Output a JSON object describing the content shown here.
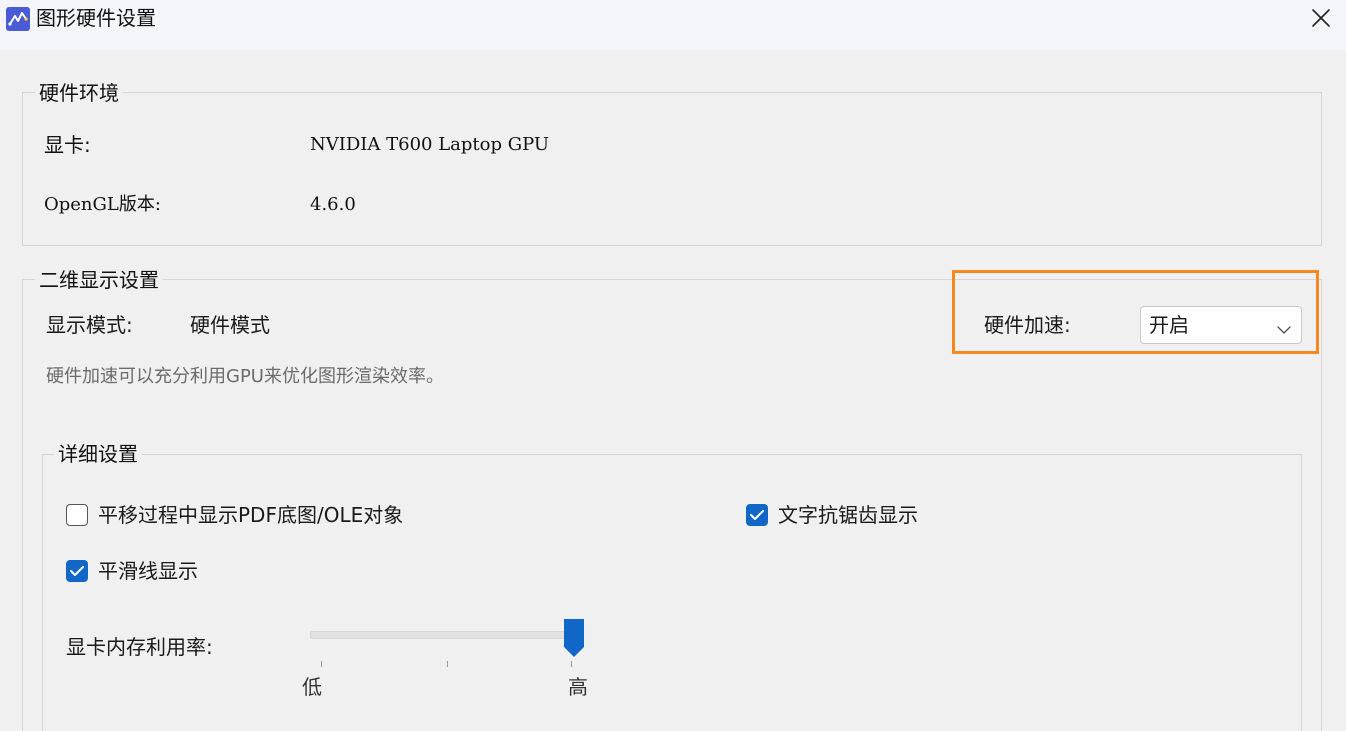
{
  "window": {
    "title": "图形硬件设置"
  },
  "hardware": {
    "legend": "硬件环境",
    "gpu_label": "显卡:",
    "gpu_value": "NVIDIA T600 Laptop GPU",
    "opengl_label": "OpenGL版本:",
    "opengl_value": "4.6.0"
  },
  "display2d": {
    "legend": "二维显示设置",
    "mode_label": "显示模式:",
    "mode_value": "硬件模式",
    "hint": "硬件加速可以充分利用GPU来优化图形渲染效率。",
    "accel_label": "硬件加速:",
    "accel_selected": "开启"
  },
  "details": {
    "legend": "详细设置",
    "options": [
      {
        "label": "平移过程中显示PDF底图/OLE对象",
        "checked": false
      },
      {
        "label": "文字抗锯齿显示",
        "checked": true
      },
      {
        "label": "平滑线显示",
        "checked": true
      }
    ],
    "memory_label": "显卡内存利用率:",
    "slider_min_label": "低",
    "slider_max_label": "高",
    "memory_level": 1.0
  },
  "colors": {
    "accent": "#1067c8",
    "highlight": "#f5891f"
  },
  "icons": {
    "app": "app-logo-icon",
    "close": "close-icon",
    "dropdown": "chevron-down-icon",
    "check": "checkmark-icon"
  }
}
